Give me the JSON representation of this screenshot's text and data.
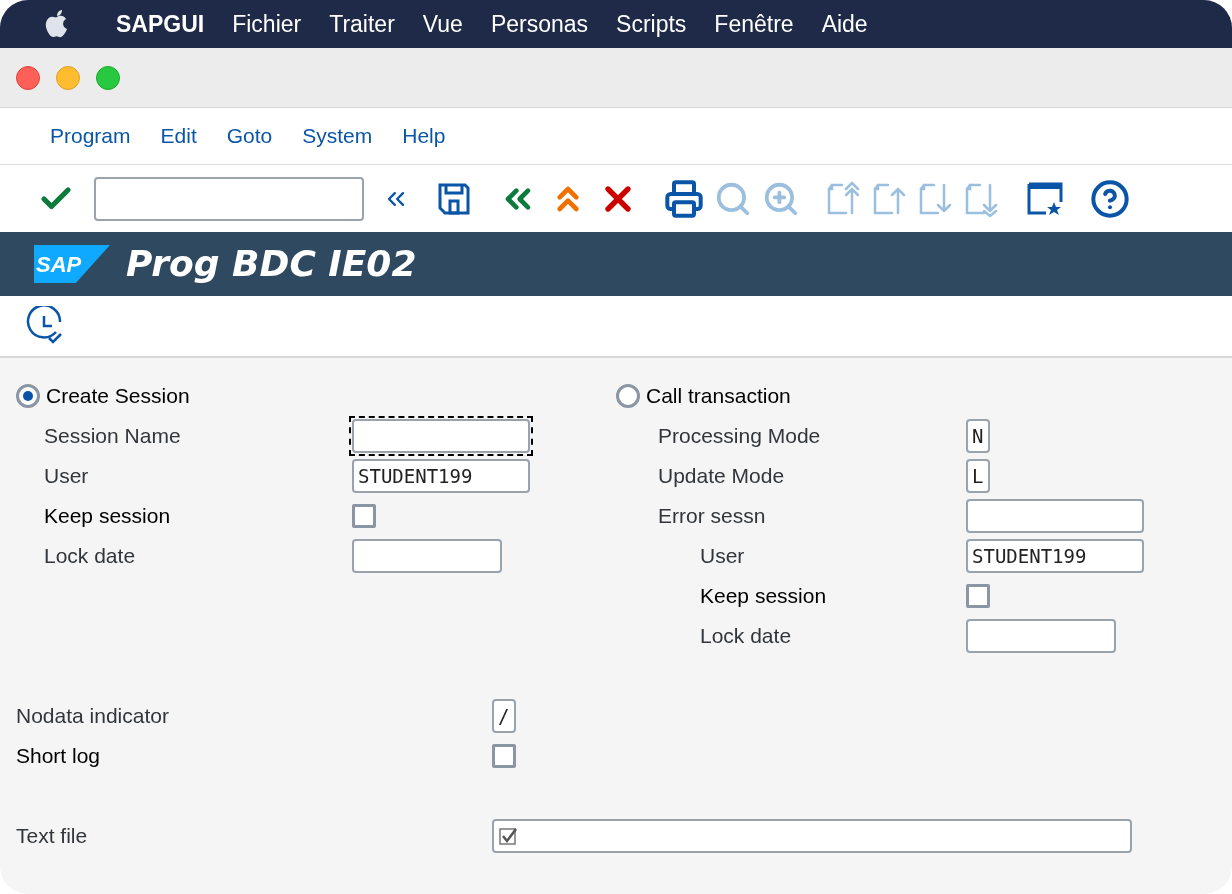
{
  "mac_menubar": {
    "app": "SAPGUI",
    "items": [
      "Fichier",
      "Traiter",
      "Vue",
      "Personas",
      "Scripts",
      "Fenêtre",
      "Aide"
    ]
  },
  "menu": [
    "Program",
    "Edit",
    "Goto",
    "System",
    "Help"
  ],
  "toolbar": {
    "buttons": [
      {
        "kind": "enter",
        "disabled": false
      },
      {
        "kind": "field-toggle",
        "disabled": false
      },
      {
        "kind": "save",
        "disabled": false
      },
      {
        "kind": "back",
        "disabled": false
      },
      {
        "kind": "exit",
        "disabled": false
      },
      {
        "kind": "cancel",
        "disabled": false
      },
      {
        "kind": "print",
        "disabled": false
      },
      {
        "kind": "find",
        "disabled": true
      },
      {
        "kind": "find-next",
        "disabled": true
      },
      {
        "kind": "first-page",
        "disabled": true
      },
      {
        "kind": "prev-page",
        "disabled": true
      },
      {
        "kind": "next-page",
        "disabled": true
      },
      {
        "kind": "last-page",
        "disabled": true
      },
      {
        "kind": "layout",
        "disabled": false
      },
      {
        "kind": "help",
        "disabled": false
      }
    ]
  },
  "title_bar": {
    "logo": "SAP",
    "title": "Prog BDC IE02"
  },
  "form": {
    "left": {
      "radio": {
        "label": "Create Session",
        "selected": true
      },
      "rows": [
        {
          "label": "Session Name",
          "kind": "text",
          "focused": true
        },
        {
          "label": "User",
          "kind": "text",
          "value": "STUDENT199",
          "focused": false
        },
        {
          "label": "Keep session",
          "kind": "checkbox",
          "checked": false
        },
        {
          "label": "Lock date",
          "kind": "date",
          "focused": false
        }
      ]
    },
    "right": {
      "radio": {
        "label": "Call transaction",
        "selected": false
      },
      "rows": [
        {
          "label": "Processing Mode",
          "kind": "char",
          "value": "N",
          "focused": false
        },
        {
          "label": "Update Mode",
          "kind": "char",
          "value": "L",
          "focused": false
        },
        {
          "label": "Error sessn",
          "kind": "text",
          "focused": false,
          "children": [
            {
              "label": "User",
              "kind": "text",
              "value": "STUDENT199",
              "focused": false
            },
            {
              "label": "Keep session",
              "kind": "checkbox",
              "checked": false
            },
            {
              "label": "Lock date",
              "kind": "date",
              "focused": false
            }
          ]
        }
      ]
    },
    "options": [
      {
        "label": "Nodata indicator",
        "kind": "char",
        "value": "/",
        "focused": false
      },
      {
        "label": "Short log",
        "kind": "checkbox",
        "checked": false
      }
    ],
    "file": {
      "label": "Text file",
      "kind": "file",
      "checked": true,
      "focused": false
    }
  }
}
